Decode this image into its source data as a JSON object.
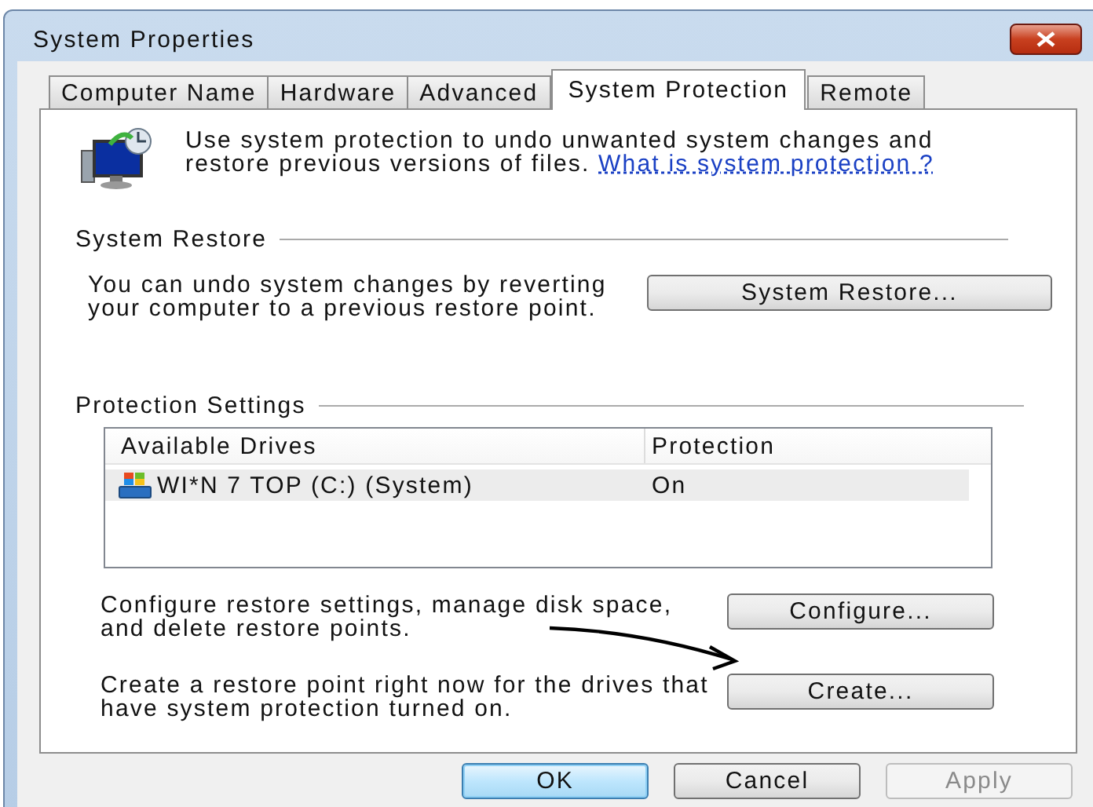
{
  "window": {
    "title": "System Properties"
  },
  "tabs": [
    {
      "label": "Computer Name",
      "selected": false
    },
    {
      "label": "Hardware",
      "selected": false
    },
    {
      "label": "Advanced",
      "selected": false
    },
    {
      "label": "System Protection",
      "selected": true
    },
    {
      "label": "Remote",
      "selected": false
    }
  ],
  "intro": {
    "text": "Use system protection to undo unwanted system changes and restore previous versions of files.",
    "link": "What is system protection ?"
  },
  "system_restore": {
    "heading": "System Restore",
    "text": "You can undo system changes by reverting your computer to a previous restore point.",
    "button": "System Restore..."
  },
  "protection_settings": {
    "heading": "Protection Settings",
    "columns": [
      "Available Drives",
      "Protection"
    ],
    "rows": [
      {
        "drive": "WI*N 7 TOP (C:) (System)",
        "protection": "On",
        "selected": true
      }
    ],
    "actions": [
      {
        "text": "Configure restore settings, manage disk space, and delete restore points.",
        "button": "Configure..."
      },
      {
        "text": "Create a restore point right now for the drives that have system protection turned on.",
        "button": "Create..."
      }
    ]
  },
  "buttons": [
    {
      "label": "OK",
      "kind": "default",
      "disabled": false
    },
    {
      "label": "Cancel",
      "kind": "normal",
      "disabled": false
    },
    {
      "label": "Apply",
      "kind": "normal",
      "disabled": true
    }
  ]
}
